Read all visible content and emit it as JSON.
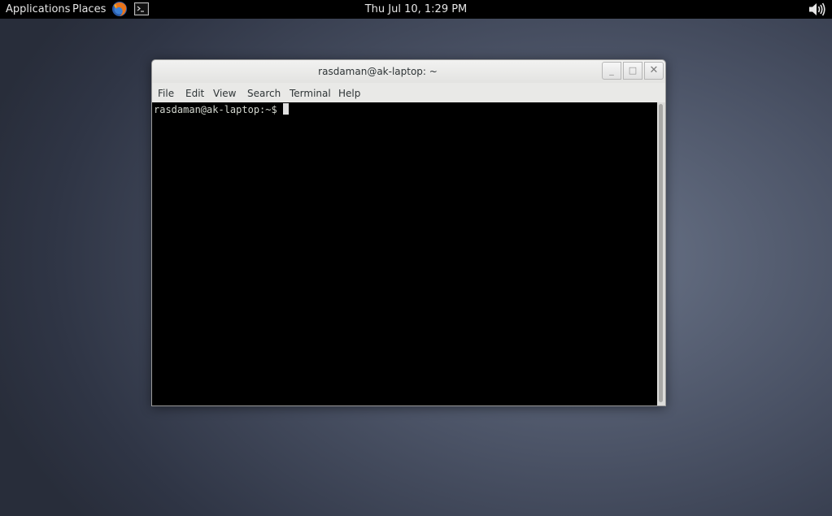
{
  "top_panel": {
    "applications_label": "Applications",
    "places_label": "Places",
    "clock": "Thu Jul 10,  1:29 PM",
    "launchers": [
      "firefox-icon",
      "terminal-icon"
    ],
    "status_icons": [
      "volume-icon"
    ]
  },
  "window": {
    "title": "rasdaman@ak-laptop: ~",
    "minimize_glyph": "_",
    "maximize_glyph": "□",
    "close_glyph": "✕"
  },
  "menubar": {
    "items": [
      "File",
      "Edit",
      "View",
      "Search",
      "Terminal",
      "Help"
    ]
  },
  "terminal": {
    "prompt": "rasdaman@ak-laptop:~$",
    "background": "#000000",
    "foreground": "#d3d7cf"
  }
}
